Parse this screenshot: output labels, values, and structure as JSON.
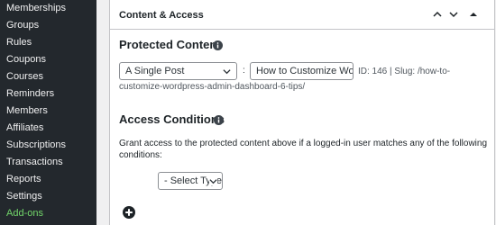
{
  "sidebar": {
    "items": [
      {
        "label": "Memberships"
      },
      {
        "label": "Groups"
      },
      {
        "label": "Rules"
      },
      {
        "label": "Coupons"
      },
      {
        "label": "Courses"
      },
      {
        "label": "Reminders"
      },
      {
        "label": "Members"
      },
      {
        "label": "Affiliates"
      },
      {
        "label": "Subscriptions"
      },
      {
        "label": "Transactions"
      },
      {
        "label": "Reports"
      },
      {
        "label": "Settings"
      },
      {
        "label": "Add-ons"
      }
    ],
    "add_ons_color": "#72d66a"
  },
  "metabox": {
    "title": "Content & Access",
    "protected_content": {
      "heading": "Protected Content",
      "type_value": "A Single Post",
      "separator": ":",
      "post_value": "How to Customize Word",
      "meta": "ID: 146 | Slug: /how-to-customize-wordpress-admin-dashboard-6-tips/"
    },
    "access_conditions": {
      "heading": "Access Conditions",
      "description": "Grant access to the protected content above if a logged-in user matches any of the following conditions:",
      "rule_select_value": "- Select Type -"
    }
  }
}
